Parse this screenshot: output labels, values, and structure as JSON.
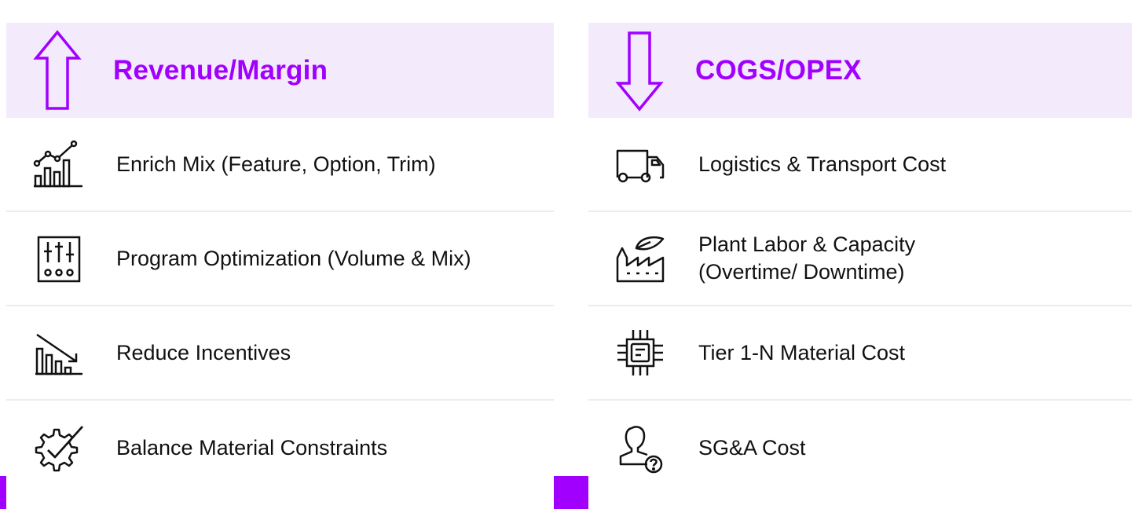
{
  "brand": {
    "accent_color": "#a100ff",
    "header_bg": "#f3eafc"
  },
  "left_panel": {
    "title": "Revenue/Margin",
    "arrow_icon": "arrow-up-icon",
    "items": [
      {
        "label": "Enrich Mix (Feature, Option, Trim)",
        "icon": "growth-chart-icon"
      },
      {
        "label": "Program Optimization (Volume & Mix)",
        "icon": "mixer-sliders-icon"
      },
      {
        "label": "Reduce Incentives",
        "icon": "declining-chart-icon"
      },
      {
        "label": "Balance Material Constraints",
        "icon": "gear-check-icon"
      }
    ]
  },
  "right_panel": {
    "title": "COGS/OPEX",
    "arrow_icon": "arrow-down-icon",
    "items": [
      {
        "label": "Logistics & Transport Cost",
        "icon": "truck-icon"
      },
      {
        "label": "Plant Labor & Capacity\n(Overtime/ Downtime)",
        "icon": "factory-icon"
      },
      {
        "label": "Tier 1-N Material Cost",
        "icon": "chip-icon"
      },
      {
        "label": "SG&A Cost",
        "icon": "person-question-icon"
      }
    ]
  }
}
